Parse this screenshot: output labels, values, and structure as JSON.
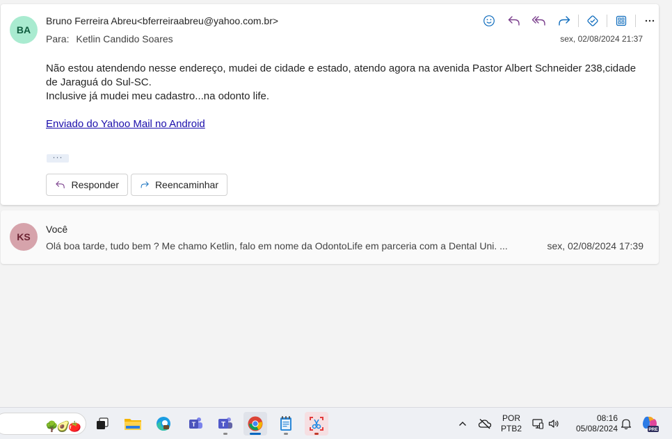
{
  "message1": {
    "avatar_initials": "BA",
    "sender": "Bruno Ferreira Abreu<bferreiraabreu@yahoo.com.br>",
    "to_label": "Para:",
    "to_name": "Ketlin Candido Soares",
    "date": "sex, 02/08/2024 21:37",
    "body_line1": "Não estou atendendo nesse endereço, mudei de cidade e estado, atendo agora na avenida Pastor Albert Schneider 238,cidade de Jaraguá do Sul-SC.",
    "body_line2": "Inclusive já mudei meu cadastro...na odonto life.",
    "signature_link": "Enviado do Yahoo Mail no Android",
    "ellipsis": "···",
    "reply_label": "Responder",
    "forward_label": "Reencaminhar",
    "toolbar_icons": [
      "emoji-icon",
      "reply-icon",
      "reply-all-icon",
      "forward-icon",
      "immersive-reader-icon",
      "apps-icon",
      "more-icon"
    ],
    "avatar_color": "#a9ebd0"
  },
  "message2": {
    "avatar_initials": "KS",
    "sender": "Você",
    "preview": "Olá boa tarde, tudo bem ? Me chamo Ketlin, falo em nome da OdontoLife em parceria com a Dental Uni. ...",
    "date": "sex, 02/08/2024 17:39",
    "avatar_color": "#d6a3ab"
  },
  "taskbar": {
    "apps": [
      "task-view",
      "file-explorer",
      "edge",
      "teams-classic",
      "teams",
      "chrome",
      "notepad",
      "snipping-tool"
    ],
    "lang_top": "POR",
    "lang_bottom": "PTB2",
    "time": "08:16",
    "date": "05/08/2024",
    "copilot_badge": "PRE"
  },
  "colors": {
    "accent": "#0f6cbd",
    "icon_purple": "#7a3e8c",
    "link": "#1a0dab"
  }
}
